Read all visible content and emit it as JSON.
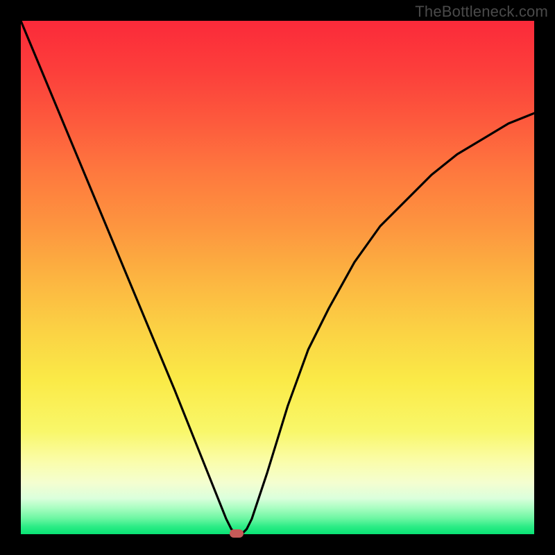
{
  "watermark": "TheBottleneck.com",
  "chart_data": {
    "type": "line",
    "title": "",
    "xlabel": "",
    "ylabel": "",
    "xlim": [
      0,
      100
    ],
    "ylim": [
      0,
      100
    ],
    "series": [
      {
        "name": "bottleneck-curve",
        "x": [
          0,
          5,
          10,
          15,
          20,
          25,
          30,
          34,
          38,
          40,
          41,
          42,
          43,
          44,
          45,
          48,
          52,
          56,
          60,
          65,
          70,
          75,
          80,
          85,
          90,
          95,
          100
        ],
        "y": [
          100,
          88,
          76,
          64,
          52,
          40,
          28,
          18,
          8,
          3,
          1,
          0,
          0,
          1,
          3,
          12,
          25,
          36,
          44,
          53,
          60,
          65,
          70,
          74,
          77,
          80,
          82
        ]
      }
    ],
    "marker": {
      "x": 42,
      "y": 0
    },
    "gradient_stops": [
      {
        "pct": 0,
        "color": "#fb2a3a"
      },
      {
        "pct": 50,
        "color": "#fcb441"
      },
      {
        "pct": 80,
        "color": "#f9f76a"
      },
      {
        "pct": 100,
        "color": "#08e374"
      }
    ]
  }
}
